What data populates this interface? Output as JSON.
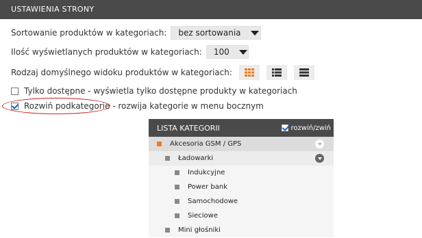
{
  "header": {
    "title": "USTAWIENIA STRONY"
  },
  "settings": {
    "sorting": {
      "label": "Sortowanie produktów w kategoriach:",
      "value": "bez sortowania"
    },
    "count": {
      "label": "Ilość wyświetlanych produktów w kategoriach:",
      "value": "100"
    },
    "view": {
      "label": "Rodzaj domyślnego widoku produktów w kategoriach:"
    },
    "only_available": {
      "label": "Tylko dostępne - wyświetla tylko dostępne produkty w kategoriach",
      "checked": false
    },
    "expand_sub": {
      "label": "Rozwiń podkategorie - rozwija kategorie w menu bocznym",
      "checked": true
    }
  },
  "category_panel": {
    "title": "LISTA KATEGORII",
    "toggle_label": "rozwiń/zwiń",
    "items": [
      {
        "label": "Akcesoria GSM / GPS",
        "level": 0
      },
      {
        "label": "Ładowarki",
        "level": 1
      },
      {
        "label": "Indukcyjne",
        "level": 2
      },
      {
        "label": "Power bank",
        "level": 2
      },
      {
        "label": "Samochodowe",
        "level": 2
      },
      {
        "label": "Sieciowe",
        "level": 2
      },
      {
        "label": "Mini głośniki",
        "level": 1
      }
    ]
  },
  "colors": {
    "header_bg": "#4a4a4a",
    "accent": "#f07c1e",
    "highlight": "#c81e1e"
  },
  "icons": [
    "grid-view-icon",
    "list-view-icon",
    "compact-list-icon",
    "chevron-down-icon"
  ]
}
